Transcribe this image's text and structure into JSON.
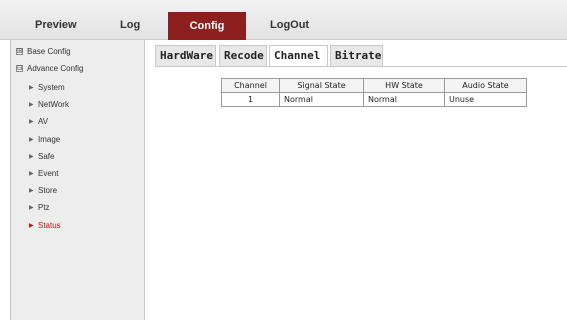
{
  "top_nav": {
    "preview": "Preview",
    "log": "Log",
    "config": "Config",
    "logout": "LogOut",
    "active_color": "#8d1f1f"
  },
  "sidebar": {
    "groups": [
      {
        "label": "Base Config",
        "state": "collapsed",
        "marker": "⊞"
      },
      {
        "label": "Advance Config",
        "state": "expanded",
        "marker": "⊟"
      }
    ],
    "items": [
      {
        "label": "System"
      },
      {
        "label": "NetWork"
      },
      {
        "label": "AV"
      },
      {
        "label": "Image"
      },
      {
        "label": "Safe"
      },
      {
        "label": "Event"
      },
      {
        "label": "Store"
      },
      {
        "label": "Ptz"
      },
      {
        "label": "Status",
        "active": true
      }
    ],
    "active_color": "#d01010"
  },
  "sub_tabs": [
    {
      "label": "HardWare"
    },
    {
      "label": "Recode"
    },
    {
      "label": "Channel",
      "active": true
    },
    {
      "label": "Bitrate"
    }
  ],
  "status_table": {
    "headers": [
      "Channel",
      "Signal State",
      "HW State",
      "Audio State"
    ],
    "rows": [
      [
        "1",
        "Normal",
        "Normal",
        "Unuse"
      ]
    ]
  }
}
